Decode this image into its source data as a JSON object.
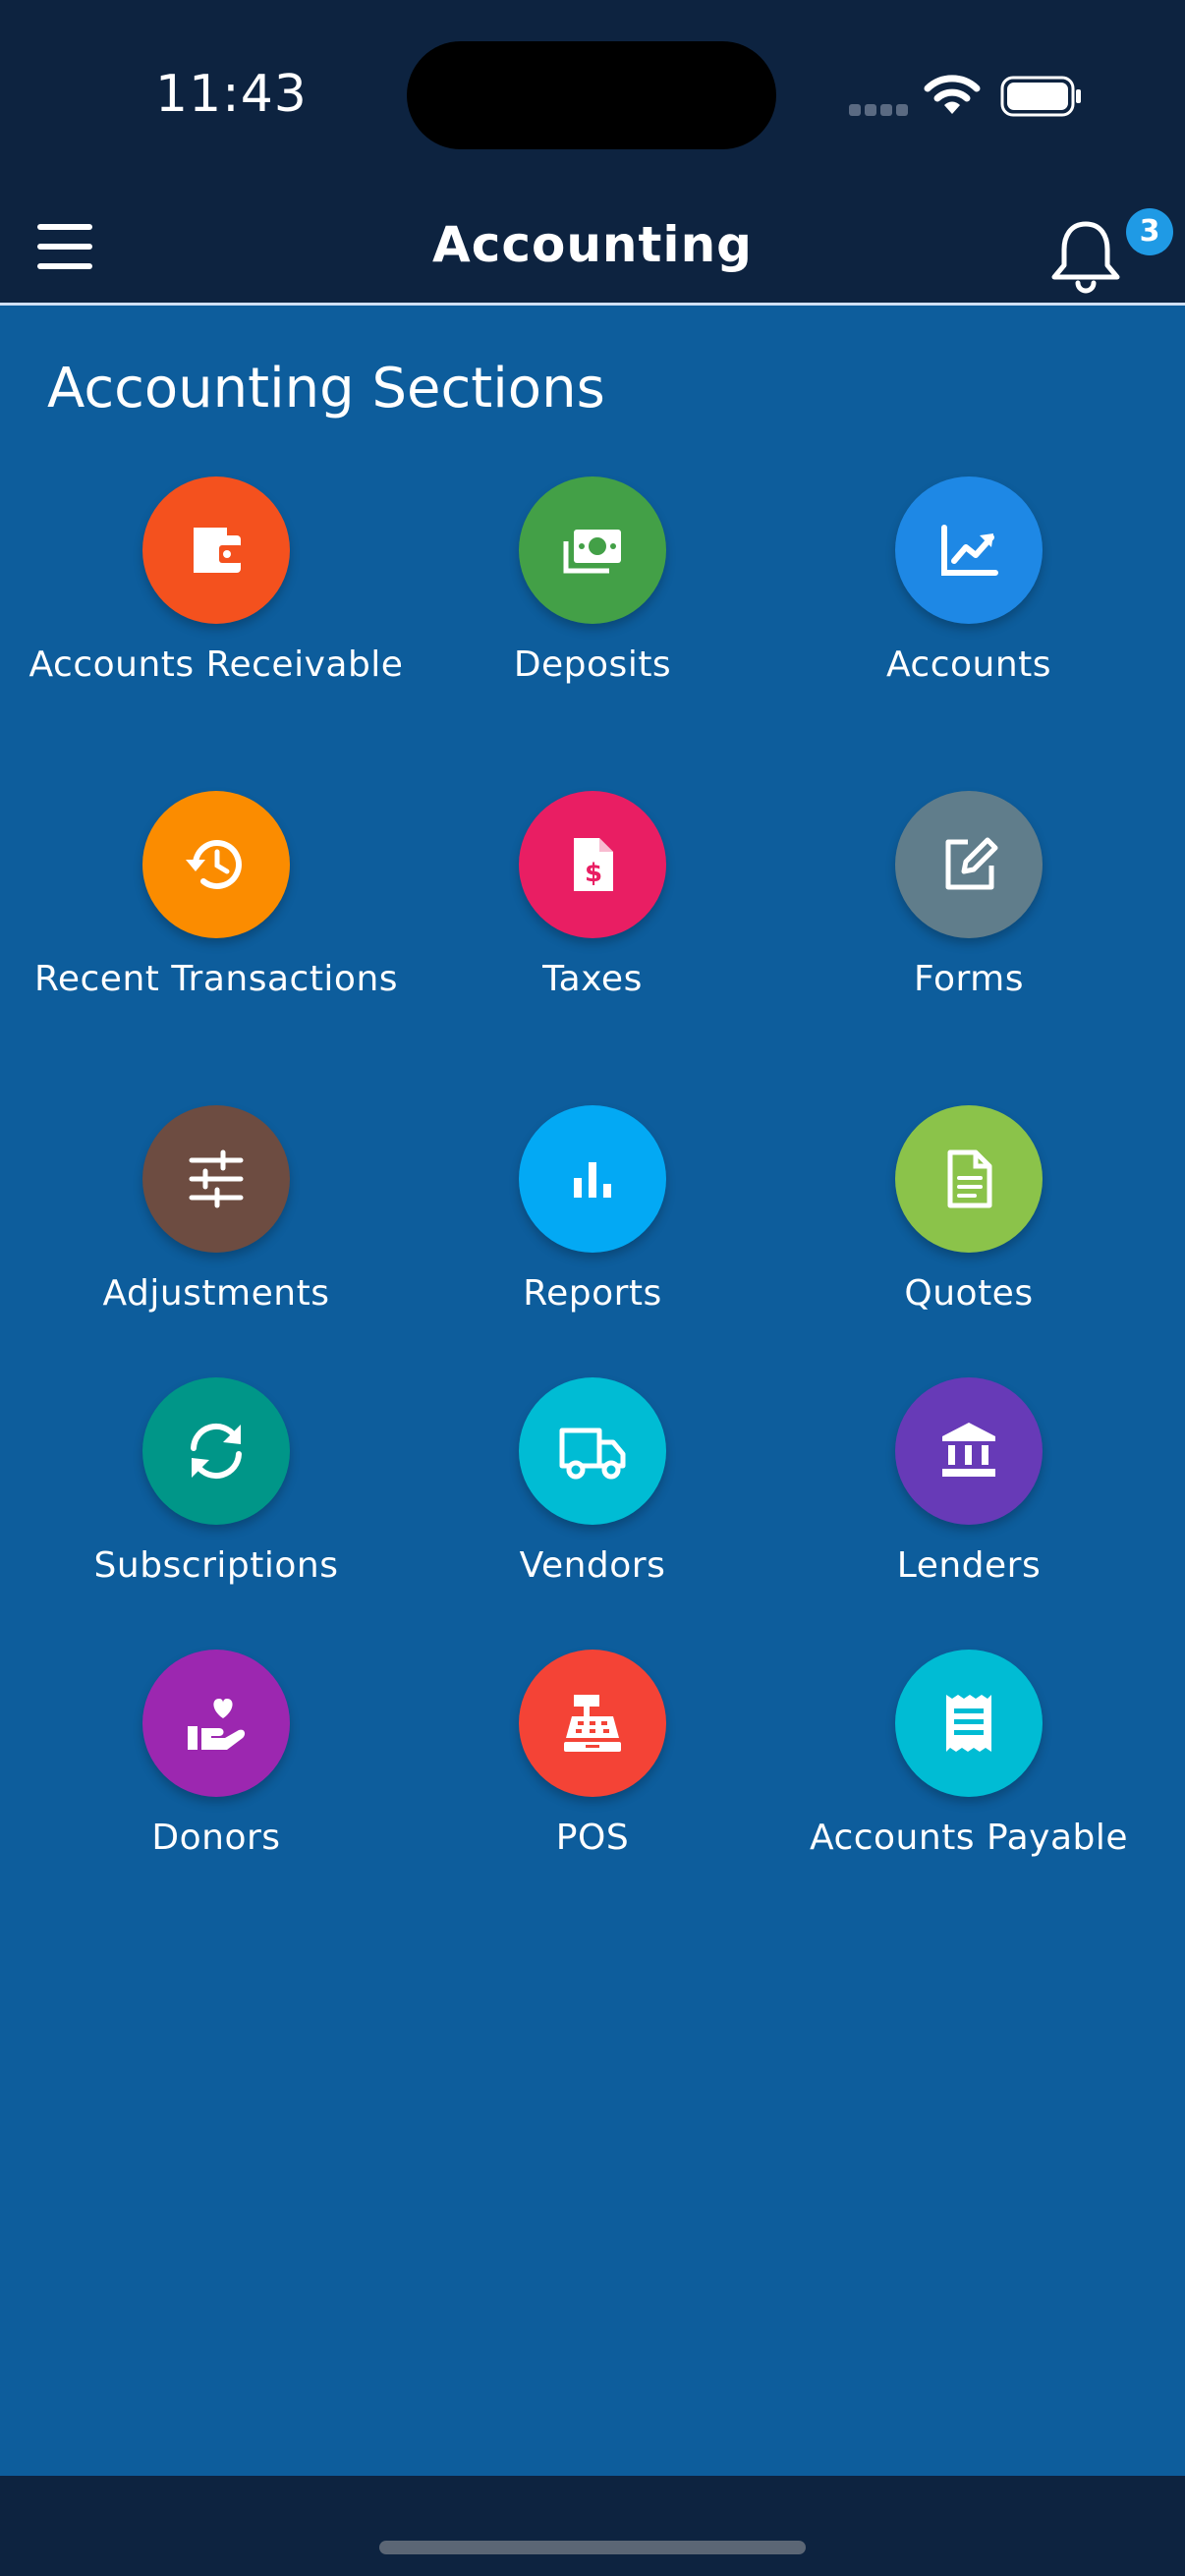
{
  "status_bar": {
    "time": "11:43"
  },
  "header": {
    "title": "Accounting",
    "notification_count": "3"
  },
  "main": {
    "section_title": "Accounting Sections",
    "items": [
      {
        "label": "Accounts Receivable",
        "icon": "wallet-icon",
        "color": "#f4511e"
      },
      {
        "label": "Deposits",
        "icon": "money-icon",
        "color": "#43a047"
      },
      {
        "label": "Accounts",
        "icon": "trending-chart-icon",
        "color": "#1e88e5"
      },
      {
        "label": "Recent Transactions",
        "icon": "history-icon",
        "color": "#fb8c00"
      },
      {
        "label": "Taxes",
        "icon": "tax-document-icon",
        "color": "#e91e63"
      },
      {
        "label": "Forms",
        "icon": "edit-icon",
        "color": "#607d8b"
      },
      {
        "label": "Adjustments",
        "icon": "sliders-icon",
        "color": "#6d4c41"
      },
      {
        "label": "Reports",
        "icon": "bar-chart-icon",
        "color": "#03a9f4"
      },
      {
        "label": "Quotes",
        "icon": "document-icon",
        "color": "#8bc34a"
      },
      {
        "label": "Subscriptions",
        "icon": "sync-icon",
        "color": "#009688"
      },
      {
        "label": "Vendors",
        "icon": "truck-icon",
        "color": "#00bcd4"
      },
      {
        "label": "Lenders",
        "icon": "bank-icon",
        "color": "#673ab7"
      },
      {
        "label": "Donors",
        "icon": "donate-heart-icon",
        "color": "#9c27b0"
      },
      {
        "label": "POS",
        "icon": "cash-register-icon",
        "color": "#f44336"
      },
      {
        "label": "Accounts Payable",
        "icon": "receipt-icon",
        "color": "#00bcd4"
      }
    ]
  }
}
